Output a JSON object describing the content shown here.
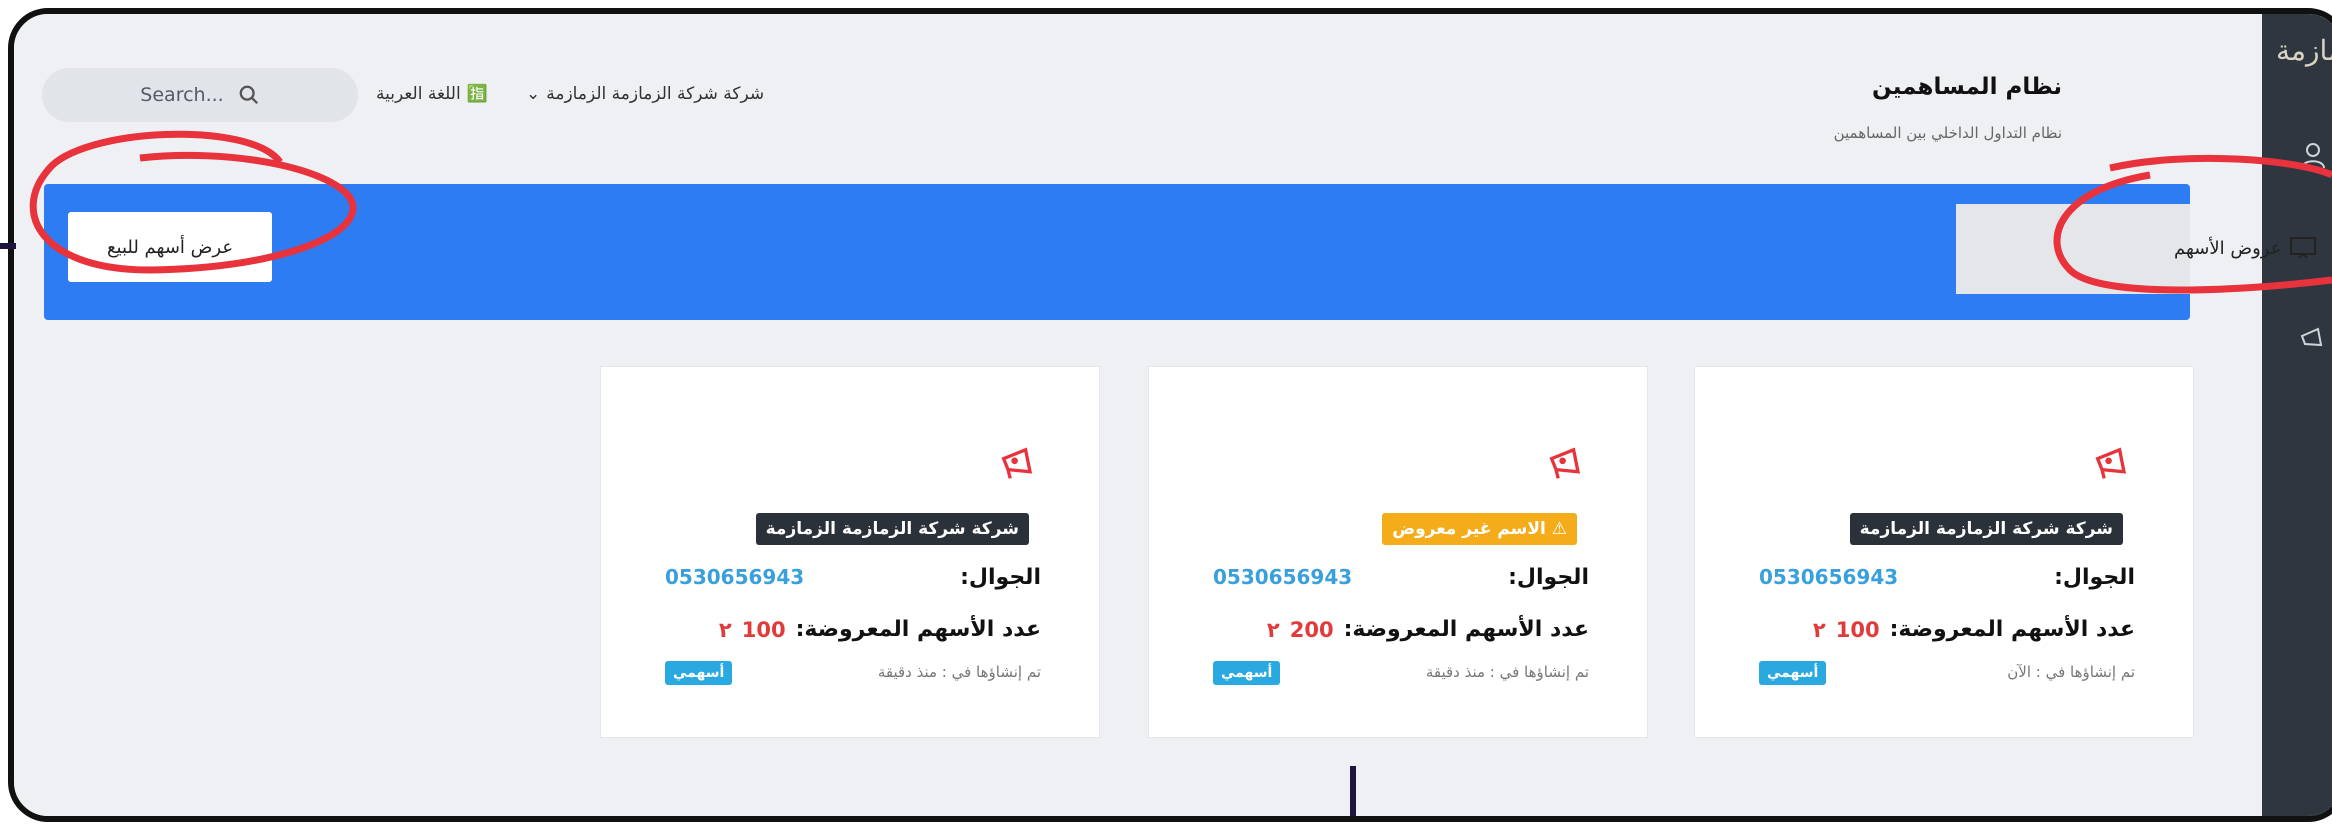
{
  "header": {
    "search_placeholder": "Search...",
    "language": "اللغة العربية",
    "company_menu": "شركة شركة الزمازمة الزمازمة",
    "app_title": "نظام المساهمين",
    "app_subtitle": "نظام التداول الداخلي بين المساهمين"
  },
  "toolbar": {
    "offer_button": "عرض أسهم للبيع"
  },
  "sidebar": {
    "logo_text": "زمازمة",
    "active_item": "عروض الأسهم"
  },
  "labels": {
    "phone": "الجوال:",
    "offered_shares": "عدد الأسهم المعروضة:",
    "my_shares": "أسهمي"
  },
  "cards": [
    {
      "company": "شركة شركة الزمازمة الزمازمة",
      "phone": "0530656943",
      "shares": "100",
      "created": "تم إنشاؤها في : الآن"
    },
    {
      "company": "⚠ الاسم غير معروض",
      "phone": "0530656943",
      "shares": "200",
      "created": "تم إنشاؤها في : منذ دقيقة"
    },
    {
      "company": "شركة شركة الزمازمة الزمازمة",
      "phone": "0530656943",
      "shares": "100",
      "created": "تم إنشاؤها في : منذ دقيقة"
    }
  ],
  "colors": {
    "accent": "#2e7cf2",
    "annotation": "#e8323c",
    "warning": "#f4ac1b",
    "phone": "#3aa0dc",
    "sidebar": "#2f3640"
  }
}
